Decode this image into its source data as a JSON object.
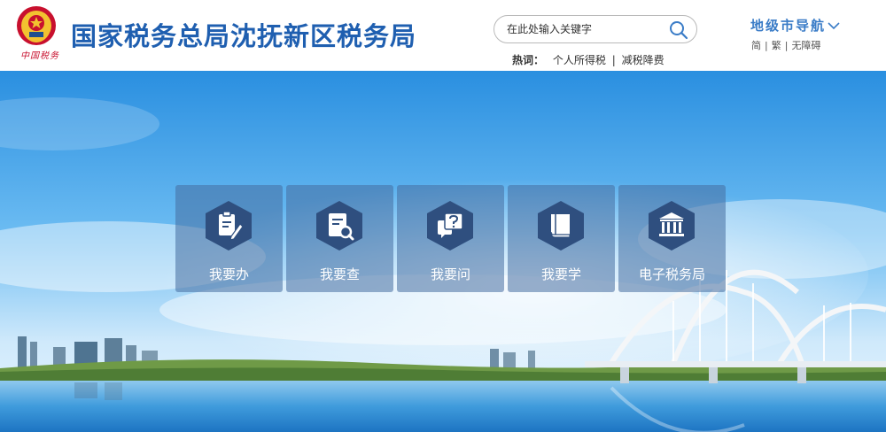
{
  "header": {
    "logo_text": "中国税务",
    "site_title": "国家税务总局沈抚新区税务局"
  },
  "search": {
    "placeholder": "在此处输入关键字",
    "icon": "search-icon"
  },
  "hotwords": {
    "label": "热词：",
    "items": [
      "个人所得税",
      "减税降费"
    ]
  },
  "city_nav": {
    "label": "地级市导航",
    "icon": "chevron-down-icon"
  },
  "languages": [
    "简",
    "繁",
    "无障碍"
  ],
  "tiles": [
    {
      "label": "我要办",
      "icon": "edit-document-icon"
    },
    {
      "label": "我要查",
      "icon": "search-document-icon"
    },
    {
      "label": "我要问",
      "icon": "question-chat-icon"
    },
    {
      "label": "我要学",
      "icon": "book-icon"
    },
    {
      "label": "电子税务局",
      "icon": "bank-building-icon"
    }
  ],
  "colors": {
    "title_blue": "#1f5fb0",
    "nav_blue": "#3a7cc7",
    "tile_hex": "#2f4f7f",
    "emblem_red": "#c8102e"
  }
}
